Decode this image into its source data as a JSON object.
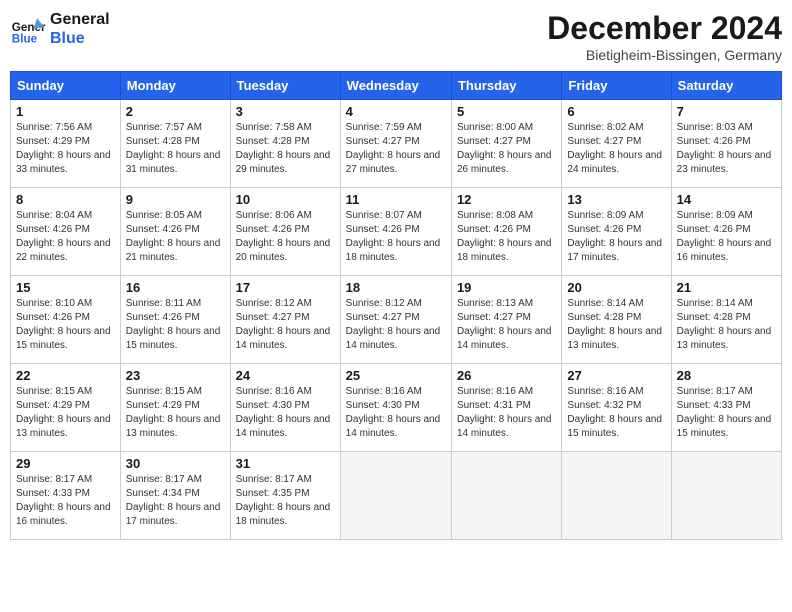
{
  "header": {
    "logo_line1": "General",
    "logo_line2": "Blue",
    "month": "December 2024",
    "location": "Bietigheim-Bissingen, Germany"
  },
  "days_of_week": [
    "Sunday",
    "Monday",
    "Tuesday",
    "Wednesday",
    "Thursday",
    "Friday",
    "Saturday"
  ],
  "weeks": [
    [
      {
        "day": 1,
        "sunrise": "7:56 AM",
        "sunset": "4:29 PM",
        "daylight": "8 hours and 33 minutes."
      },
      {
        "day": 2,
        "sunrise": "7:57 AM",
        "sunset": "4:28 PM",
        "daylight": "8 hours and 31 minutes."
      },
      {
        "day": 3,
        "sunrise": "7:58 AM",
        "sunset": "4:28 PM",
        "daylight": "8 hours and 29 minutes."
      },
      {
        "day": 4,
        "sunrise": "7:59 AM",
        "sunset": "4:27 PM",
        "daylight": "8 hours and 27 minutes."
      },
      {
        "day": 5,
        "sunrise": "8:00 AM",
        "sunset": "4:27 PM",
        "daylight": "8 hours and 26 minutes."
      },
      {
        "day": 6,
        "sunrise": "8:02 AM",
        "sunset": "4:27 PM",
        "daylight": "8 hours and 24 minutes."
      },
      {
        "day": 7,
        "sunrise": "8:03 AM",
        "sunset": "4:26 PM",
        "daylight": "8 hours and 23 minutes."
      }
    ],
    [
      {
        "day": 8,
        "sunrise": "8:04 AM",
        "sunset": "4:26 PM",
        "daylight": "8 hours and 22 minutes."
      },
      {
        "day": 9,
        "sunrise": "8:05 AM",
        "sunset": "4:26 PM",
        "daylight": "8 hours and 21 minutes."
      },
      {
        "day": 10,
        "sunrise": "8:06 AM",
        "sunset": "4:26 PM",
        "daylight": "8 hours and 20 minutes."
      },
      {
        "day": 11,
        "sunrise": "8:07 AM",
        "sunset": "4:26 PM",
        "daylight": "8 hours and 18 minutes."
      },
      {
        "day": 12,
        "sunrise": "8:08 AM",
        "sunset": "4:26 PM",
        "daylight": "8 hours and 18 minutes."
      },
      {
        "day": 13,
        "sunrise": "8:09 AM",
        "sunset": "4:26 PM",
        "daylight": "8 hours and 17 minutes."
      },
      {
        "day": 14,
        "sunrise": "8:09 AM",
        "sunset": "4:26 PM",
        "daylight": "8 hours and 16 minutes."
      }
    ],
    [
      {
        "day": 15,
        "sunrise": "8:10 AM",
        "sunset": "4:26 PM",
        "daylight": "8 hours and 15 minutes."
      },
      {
        "day": 16,
        "sunrise": "8:11 AM",
        "sunset": "4:26 PM",
        "daylight": "8 hours and 15 minutes."
      },
      {
        "day": 17,
        "sunrise": "8:12 AM",
        "sunset": "4:27 PM",
        "daylight": "8 hours and 14 minutes."
      },
      {
        "day": 18,
        "sunrise": "8:12 AM",
        "sunset": "4:27 PM",
        "daylight": "8 hours and 14 minutes."
      },
      {
        "day": 19,
        "sunrise": "8:13 AM",
        "sunset": "4:27 PM",
        "daylight": "8 hours and 14 minutes."
      },
      {
        "day": 20,
        "sunrise": "8:14 AM",
        "sunset": "4:28 PM",
        "daylight": "8 hours and 13 minutes."
      },
      {
        "day": 21,
        "sunrise": "8:14 AM",
        "sunset": "4:28 PM",
        "daylight": "8 hours and 13 minutes."
      }
    ],
    [
      {
        "day": 22,
        "sunrise": "8:15 AM",
        "sunset": "4:29 PM",
        "daylight": "8 hours and 13 minutes."
      },
      {
        "day": 23,
        "sunrise": "8:15 AM",
        "sunset": "4:29 PM",
        "daylight": "8 hours and 13 minutes."
      },
      {
        "day": 24,
        "sunrise": "8:16 AM",
        "sunset": "4:30 PM",
        "daylight": "8 hours and 14 minutes."
      },
      {
        "day": 25,
        "sunrise": "8:16 AM",
        "sunset": "4:30 PM",
        "daylight": "8 hours and 14 minutes."
      },
      {
        "day": 26,
        "sunrise": "8:16 AM",
        "sunset": "4:31 PM",
        "daylight": "8 hours and 14 minutes."
      },
      {
        "day": 27,
        "sunrise": "8:16 AM",
        "sunset": "4:32 PM",
        "daylight": "8 hours and 15 minutes."
      },
      {
        "day": 28,
        "sunrise": "8:17 AM",
        "sunset": "4:33 PM",
        "daylight": "8 hours and 15 minutes."
      }
    ],
    [
      {
        "day": 29,
        "sunrise": "8:17 AM",
        "sunset": "4:33 PM",
        "daylight": "8 hours and 16 minutes."
      },
      {
        "day": 30,
        "sunrise": "8:17 AM",
        "sunset": "4:34 PM",
        "daylight": "8 hours and 17 minutes."
      },
      {
        "day": 31,
        "sunrise": "8:17 AM",
        "sunset": "4:35 PM",
        "daylight": "8 hours and 18 minutes."
      },
      null,
      null,
      null,
      null
    ]
  ]
}
